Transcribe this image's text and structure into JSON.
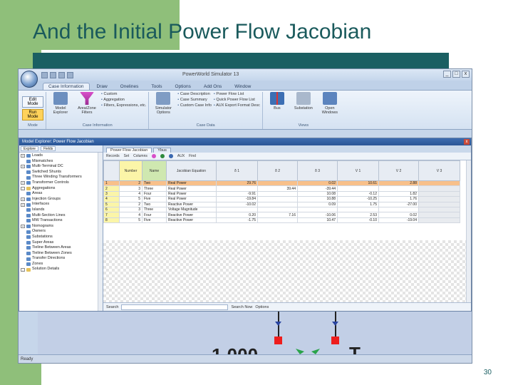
{
  "slide": {
    "title": "And the Initial Power Flow Jacobian",
    "page_number": "30"
  },
  "app": {
    "window_title": "PowerWorld Simulator 13",
    "ribbon_tabs": [
      "Case Information",
      "Draw",
      "Onelines",
      "Tools",
      "Options",
      "Add Ons",
      "Window"
    ],
    "groups": {
      "mode": {
        "edit": "Edit Mode",
        "run": "Run Mode",
        "label": "Mode"
      },
      "case_info": {
        "buttons": [
          "Model Explorer",
          "Area/Zone Filters"
        ],
        "list": [
          "Custom",
          "Aggregation",
          "Filters, Expressions, etc."
        ],
        "label": "Case Information"
      },
      "case_data": {
        "buttons": [
          "Simulator Options"
        ],
        "list_a": [
          "Case Description",
          "Case Summary",
          "Custom Case Info"
        ],
        "list_b": [
          "Power Flow List",
          "Quick Power Flow List",
          "AUX Export Format Desc"
        ],
        "label": "Case Data"
      },
      "views": {
        "buttons": [
          "Bus",
          "Substation",
          "Open Windows"
        ],
        "label": "Views"
      }
    }
  },
  "explorer": {
    "title": "Model Explorer: Power Flow Jacobian",
    "tree_toolbar": [
      "Explore",
      "Fields"
    ],
    "tree_items": [
      {
        "text": "Loads",
        "type": "item",
        "expand": "+"
      },
      {
        "text": "Mismatches",
        "type": "item",
        "expand": ""
      },
      {
        "text": "Multi-Terminal DC",
        "type": "item",
        "expand": "+"
      },
      {
        "text": "Switched Shunts",
        "type": "item",
        "expand": ""
      },
      {
        "text": "Three Winding Transformers",
        "type": "item",
        "expand": ""
      },
      {
        "text": "Transformer Controls",
        "type": "item",
        "expand": "+"
      },
      {
        "text": "Aggregations",
        "type": "folder",
        "expand": "-"
      },
      {
        "text": "Areas",
        "type": "item",
        "expand": ""
      },
      {
        "text": "Injection Groups",
        "type": "item",
        "expand": "+"
      },
      {
        "text": "Interfaces",
        "type": "item",
        "expand": "+"
      },
      {
        "text": "Islands",
        "type": "item",
        "expand": ""
      },
      {
        "text": "Multi-Section Lines",
        "type": "item",
        "expand": ""
      },
      {
        "text": "MW Transactions",
        "type": "item",
        "expand": ""
      },
      {
        "text": "Nomograms",
        "type": "item",
        "expand": "+"
      },
      {
        "text": "Owners",
        "type": "item",
        "expand": ""
      },
      {
        "text": "Substations",
        "type": "item",
        "expand": ""
      },
      {
        "text": "Super Areas",
        "type": "item",
        "expand": ""
      },
      {
        "text": "Tieline Between Areas",
        "type": "item",
        "expand": ""
      },
      {
        "text": "Tieline Between Zones",
        "type": "item",
        "expand": ""
      },
      {
        "text": "Transfer Directions",
        "type": "item",
        "expand": ""
      },
      {
        "text": "Zones",
        "type": "item",
        "expand": ""
      },
      {
        "text": "Solution Details",
        "type": "folder",
        "expand": "-"
      }
    ],
    "doc_tabs": [
      "Power Flow Jacobian",
      "Ybus"
    ],
    "toolbar": [
      "Records",
      "Set",
      "Columns",
      "AUX",
      "Find"
    ],
    "columns": [
      "",
      "Number",
      "Name",
      "Jacobian Equation",
      "δ 1",
      "δ 2",
      "δ 3",
      "V 1",
      "V 2",
      "V 3"
    ],
    "rows": [
      [
        "1",
        "2",
        "Two",
        "Real Power",
        "29.76",
        "",
        "0.02",
        "10.61",
        "2.88"
      ],
      [
        "2",
        "3",
        "Three",
        "Real Power",
        "",
        "39.44",
        "-39.44",
        "",
        ""
      ],
      [
        "3",
        "4",
        "Four",
        "Real Power",
        "-9.91",
        "",
        "10.08",
        "-0.12",
        "1.82"
      ],
      [
        "4",
        "5",
        "Five",
        "Real Power",
        "-19.84",
        "",
        "10.88",
        "-10.25",
        "1.76"
      ],
      [
        "5",
        "2",
        "Two",
        "Reactive Power",
        "-10.02",
        "",
        "0.09",
        "1.75",
        "-27.00"
      ],
      [
        "6",
        "3",
        "Three",
        "Voltage Magnitude",
        "",
        "",
        "",
        "",
        ""
      ],
      [
        "7",
        "4",
        "Four",
        "Reactive Power",
        "0.20",
        "7.16",
        "-10.06",
        "2.53",
        "0.02"
      ],
      [
        "8",
        "5",
        "Five",
        "Reactive Power",
        "-1.75",
        "",
        "10.47",
        "-0.10",
        "-19.04"
      ]
    ],
    "search_label": "Search",
    "search_now": "Search Now",
    "options": "Options"
  },
  "oneline": {
    "value_text": "1.000",
    "letter": "T"
  },
  "status": "Ready"
}
